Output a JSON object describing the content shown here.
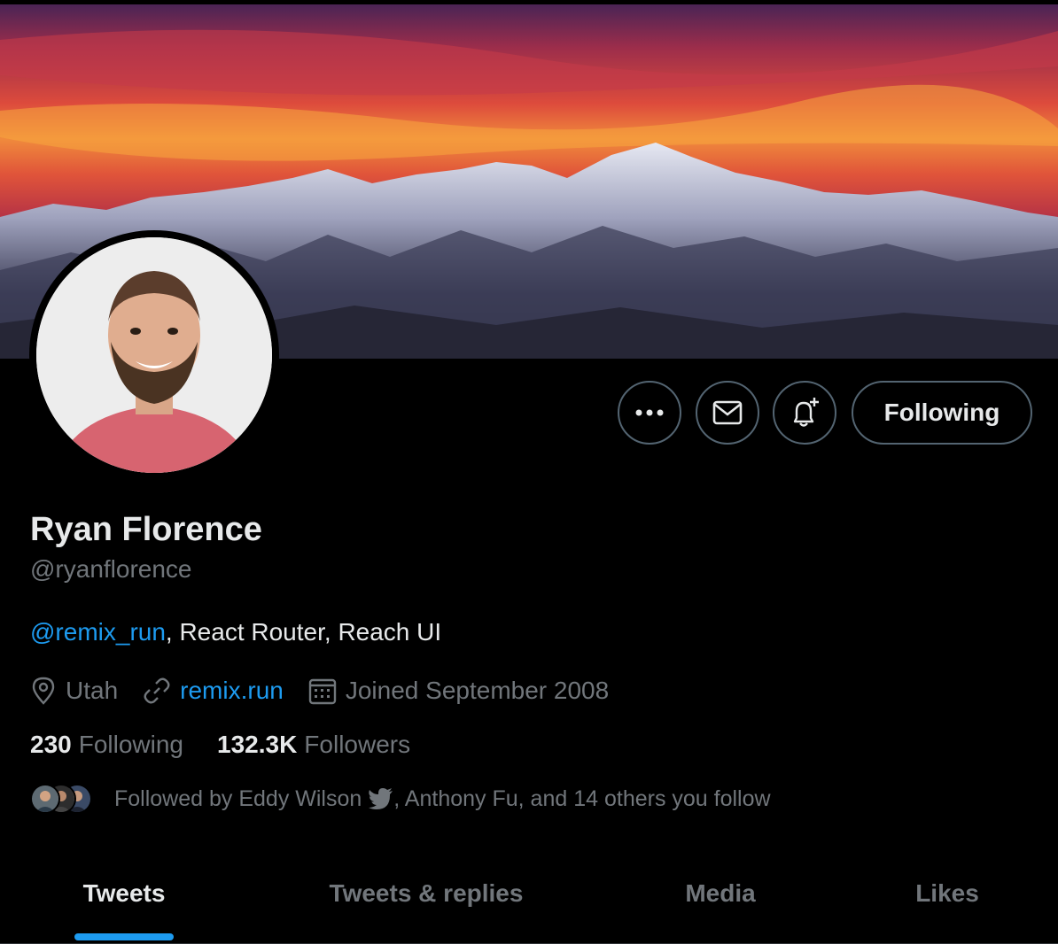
{
  "profile": {
    "name": "Ryan Florence",
    "handle": "@ryanflorence",
    "bio_link": "@remix_run",
    "bio_rest": ", React Router, Reach UI",
    "location": "Utah",
    "website": "remix.run",
    "joined": "Joined September 2008"
  },
  "actions": {
    "following_label": "Following"
  },
  "stats": {
    "following_count": "230",
    "following_label": "Following",
    "followers_count": "132.3K",
    "followers_label": "Followers"
  },
  "followed_by": {
    "prefix": "Followed by Eddy Wilson",
    "suffix": ", Anthony Fu, and 14 others you follow"
  },
  "tabs": [
    {
      "label": "Tweets",
      "active": true
    },
    {
      "label": "Tweets & replies",
      "active": false
    },
    {
      "label": "Media",
      "active": false
    },
    {
      "label": "Likes",
      "active": false
    }
  ],
  "colors": {
    "accent": "#1d9bf0",
    "background": "#000000",
    "muted": "#71767b",
    "text": "#e7e9ea"
  },
  "icons": [
    "more-icon",
    "mail-icon",
    "bell-plus-icon",
    "location-icon",
    "link-icon",
    "calendar-icon",
    "verified-bird-icon"
  ]
}
